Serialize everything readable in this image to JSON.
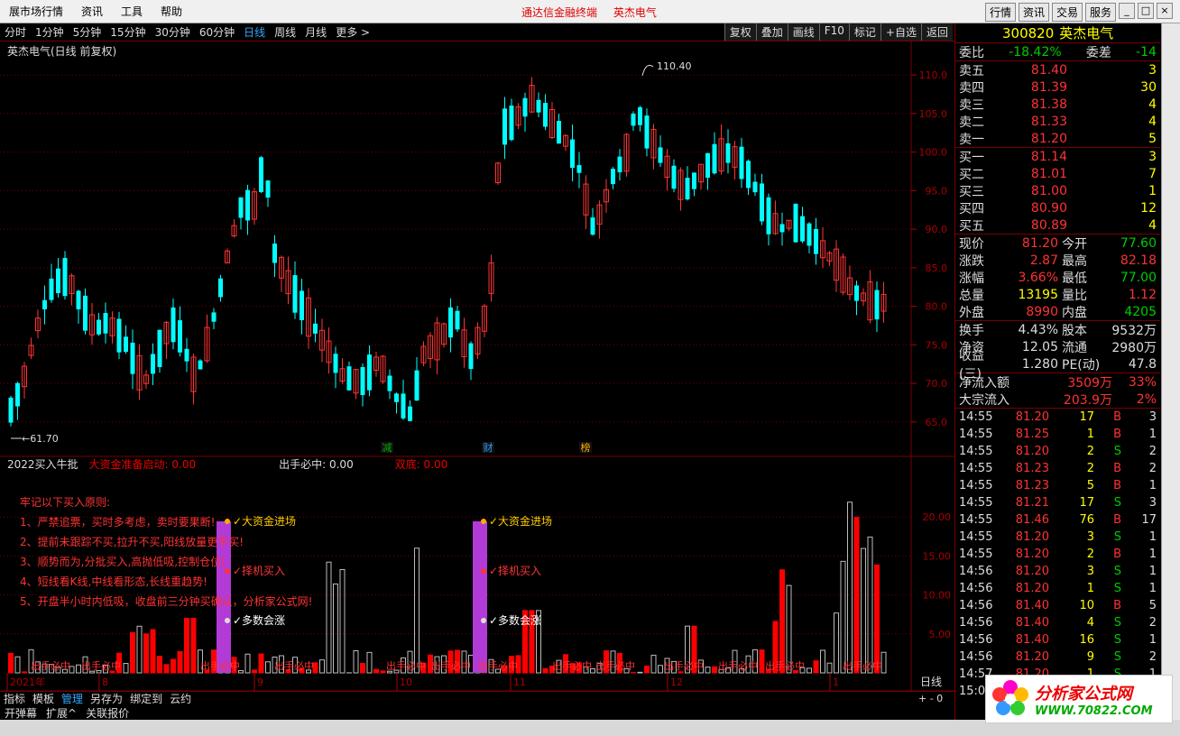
{
  "menu": {
    "items": [
      "展市场行情",
      "资讯",
      "工具",
      "帮助"
    ],
    "center": [
      "通达信金融终端",
      "英杰电气"
    ],
    "right": [
      "行情",
      "资讯",
      "交易",
      "服务"
    ],
    "win": [
      "_",
      "□",
      "×"
    ]
  },
  "periods": [
    "分时",
    "1分钟",
    "5分钟",
    "15分钟",
    "30分钟",
    "60分钟",
    "日线",
    "周线",
    "月线",
    "更多 >"
  ],
  "period_active": "日线",
  "toolbar": [
    "复权",
    "叠加",
    "画线",
    "F10",
    "标记",
    "+自选",
    "返回"
  ],
  "stock_title": "英杰电气(日线 前复权)",
  "max_label": "110.40",
  "min_label": "61.70",
  "markers": [
    "减",
    "财",
    "榜"
  ],
  "indicator": {
    "name": "2022买入牛批",
    "a": "大资金准备启动: 0.00",
    "b": "出手必中: 0.00",
    "c": "双底: 0.00"
  },
  "rules": [
    "牢记以下买入原则:",
    "1、严禁追票，买时多考虑，卖时要果断!",
    "2、提前未跟踪不买,拉升不买,阳线放量更不买!",
    "3、顺势而为,分批买入,高抛低吸,控制仓位!",
    "4、短线看K线,中线看形态,长线重趋势!",
    "5、开盘半小时内低吸，收盘前三分钟买确认，分析家公式网!"
  ],
  "signals": [
    "大资金进场",
    "择机买入",
    "多数会涨"
  ],
  "trap_label": "出手必中",
  "price_ticks": [
    "110.0",
    "105.0",
    "100.0",
    "95.0",
    "90.0",
    "85.0",
    "80.0",
    "75.0",
    "70.0",
    "65.0"
  ],
  "vol_ticks": [
    "20.00",
    "15.00",
    "10.00",
    "5.00"
  ],
  "dates": [
    "2021年",
    "8",
    "9",
    "10",
    "11",
    "12",
    "1"
  ],
  "period_right_label": "日线",
  "bottom": [
    "指标",
    "模板",
    "管理",
    "另存为",
    "绑定到",
    "云约"
  ],
  "bottom_active": "管理",
  "bottom2": [
    "开弹幕",
    "扩展^",
    "关联报价"
  ],
  "quote": {
    "code": "300820",
    "name": "英杰电气",
    "weibi_label": "委比",
    "weibi": "-18.42%",
    "weicha_label": "委差",
    "weicha": "-14",
    "asks": [
      {
        "l": "卖五",
        "p": "81.40",
        "v": "3"
      },
      {
        "l": "卖四",
        "p": "81.39",
        "v": "30"
      },
      {
        "l": "卖三",
        "p": "81.38",
        "v": "4"
      },
      {
        "l": "卖二",
        "p": "81.33",
        "v": "4"
      },
      {
        "l": "卖一",
        "p": "81.20",
        "v": "5"
      }
    ],
    "bids": [
      {
        "l": "买一",
        "p": "81.14",
        "v": "3"
      },
      {
        "l": "买二",
        "p": "81.01",
        "v": "7"
      },
      {
        "l": "买三",
        "p": "81.00",
        "v": "1"
      },
      {
        "l": "买四",
        "p": "80.90",
        "v": "12"
      },
      {
        "l": "买五",
        "p": "80.89",
        "v": "4"
      }
    ],
    "stats": [
      {
        "l1": "现价",
        "v1": "81.20",
        "c1": "red",
        "l2": "今开",
        "v2": "77.60",
        "c2": "grn"
      },
      {
        "l1": "涨跌",
        "v1": "2.87",
        "c1": "red",
        "l2": "最高",
        "v2": "82.18",
        "c2": "red"
      },
      {
        "l1": "涨幅",
        "v1": "3.66%",
        "c1": "red",
        "l2": "最低",
        "v2": "77.00",
        "c2": "grn"
      },
      {
        "l1": "总量",
        "v1": "13195",
        "c1": "yel",
        "l2": "量比",
        "v2": "1.12",
        "c2": "red"
      },
      {
        "l1": "外盘",
        "v1": "8990",
        "c1": "red",
        "l2": "内盘",
        "v2": "4205",
        "c2": "grn"
      }
    ],
    "stats2": [
      {
        "l1": "换手",
        "v1": "4.43%",
        "l2": "股本",
        "v2": "9532万"
      },
      {
        "l1": "净资",
        "v1": "12.05",
        "l2": "流通",
        "v2": "2980万"
      },
      {
        "l1": "收益(三)",
        "v1": "1.280",
        "l2": "PE(动)",
        "v2": "47.8"
      }
    ],
    "flow": [
      {
        "l": "净流入额",
        "v": "3509万",
        "p": "33%"
      },
      {
        "l": "大宗流入",
        "v": "203.9万",
        "p": "2%"
      }
    ],
    "ticks": [
      [
        "14:55",
        "81.20",
        "17",
        "B",
        "3"
      ],
      [
        "14:55",
        "81.25",
        "1",
        "B",
        "1"
      ],
      [
        "14:55",
        "81.20",
        "2",
        "S",
        "2"
      ],
      [
        "14:55",
        "81.23",
        "2",
        "B",
        "2"
      ],
      [
        "14:55",
        "81.23",
        "5",
        "B",
        "1"
      ],
      [
        "14:55",
        "81.21",
        "17",
        "S",
        "3"
      ],
      [
        "14:55",
        "81.46",
        "76",
        "B",
        "17"
      ],
      [
        "14:55",
        "81.20",
        "3",
        "S",
        "1"
      ],
      [
        "14:55",
        "81.20",
        "2",
        "B",
        "1"
      ],
      [
        "14:56",
        "81.20",
        "3",
        "S",
        "1"
      ],
      [
        "14:56",
        "81.20",
        "1",
        "S",
        "1"
      ],
      [
        "14:56",
        "81.40",
        "10",
        "B",
        "5"
      ],
      [
        "14:56",
        "81.40",
        "4",
        "S",
        "2"
      ],
      [
        "14:56",
        "81.40",
        "16",
        "S",
        "1"
      ],
      [
        "14:56",
        "81.20",
        "9",
        "S",
        "2"
      ],
      [
        "14:57",
        "81.20",
        "1",
        "S",
        "1"
      ],
      [
        "15:00",
        "",
        "",
        "",
        ""
      ]
    ]
  },
  "logo": {
    "t1": "分析家公式网",
    "t2": "WWW.70822.COM"
  }
}
